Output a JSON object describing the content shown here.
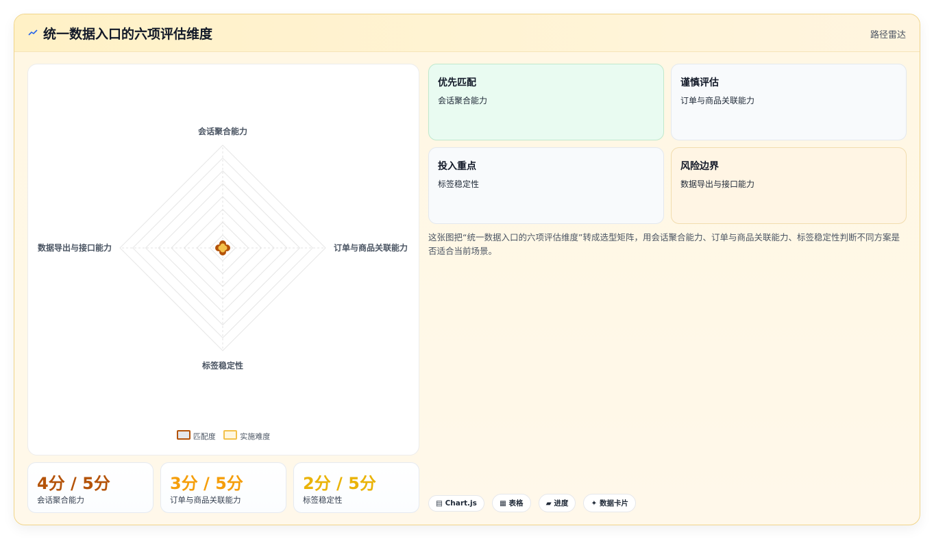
{
  "header": {
    "title": "统一数据入口的六项评估维度",
    "route_label": "路径雷达",
    "icon": "trend-icon"
  },
  "chart_data": {
    "type": "radar",
    "axes": [
      "会话聚合能力",
      "订单与商品关联能力",
      "标签稳定性",
      "数据导出与接口能力"
    ],
    "series": [
      {
        "name": "匹配度",
        "values": [
          0.2,
          0.2,
          0.2,
          0.2
        ],
        "color": "#b45309"
      },
      {
        "name": "实施难度",
        "values": [
          0.1,
          0.1,
          0.1,
          0.1
        ],
        "color": "#f3c14a"
      }
    ],
    "range": [
      0,
      5
    ],
    "grid": true
  },
  "stats": [
    {
      "value": "4分 / 5分",
      "label": "会话聚合能力",
      "color": "#b45309"
    },
    {
      "value": "3分 / 5分",
      "label": "订单与商品关联能力",
      "color": "#f59e0b"
    },
    {
      "value": "2分 / 5分",
      "label": "标签稳定性",
      "color": "#eab308"
    }
  ],
  "boxes": [
    {
      "heading": "优先匹配",
      "text": "会话聚合能力"
    },
    {
      "heading": "谨慎评估",
      "text": "订单与商品关联能力"
    },
    {
      "heading": "投入重点",
      "text": "标签稳定性"
    },
    {
      "heading": "风险边界",
      "text": "数据导出与接口能力"
    }
  ],
  "description": "这张图把“统一数据入口的六项评估维度”转成选型矩阵，用会话聚合能力、订单与商品关联能力、标签稳定性判断不同方案是否适合当前场景。",
  "chips": [
    "▤ Chart.js",
    "▦ 表格",
    "▰ 进度",
    "✦ 数据卡片"
  ],
  "colors": {
    "accent": "#b45309",
    "match_box_bg": "#e9fbf1",
    "risk_box_bg": "#fff5e4"
  }
}
